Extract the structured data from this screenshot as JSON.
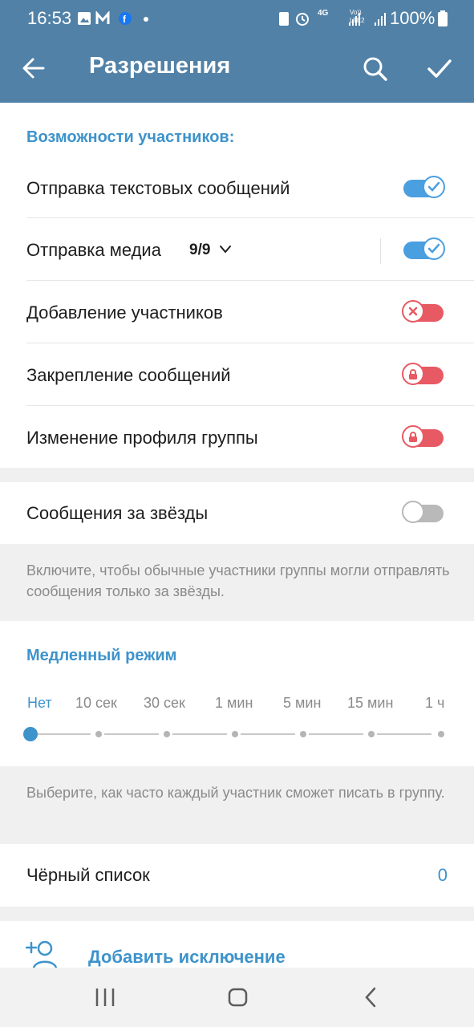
{
  "status_bar": {
    "time": "16:53",
    "battery": "100%",
    "network": "4G",
    "volte": "Vo)) LTE2"
  },
  "header": {
    "title": "Разрешения",
    "back_icon": "back-arrow-icon",
    "search_icon": "search-icon",
    "confirm_icon": "checkmark-icon"
  },
  "members_section": {
    "title": "Возможности участников:",
    "items": [
      {
        "label": "Отправка текстовых сообщений",
        "state": "on"
      },
      {
        "label": "Отправка медиа",
        "count": "9/9",
        "state": "on"
      },
      {
        "label": "Добавление участников",
        "state": "off"
      },
      {
        "label": "Закрепление сообщений",
        "state": "locked"
      },
      {
        "label": "Изменение профиля группы",
        "state": "locked"
      }
    ]
  },
  "stars": {
    "label": "Сообщения за звёзды",
    "state": "off",
    "info": "Включите, чтобы обычные участники группы могли отправлять сообщения только за звёзды."
  },
  "slow_mode": {
    "title": "Медленный режим",
    "options": [
      "Нет",
      "10 сек",
      "30 сек",
      "1 мин",
      "5 мин",
      "15 мин",
      "1 ч"
    ],
    "selected_index": 0,
    "info": "Выберите, как часто каждый участник сможет писать в группу."
  },
  "blacklist": {
    "label": "Чёрный список",
    "count": "0"
  },
  "add_exception": {
    "label": "Добавить исключение"
  },
  "colors": {
    "header": "#5181a7",
    "accent": "#3e93cb",
    "toggle_on": "#4a9fe0",
    "toggle_off_red": "#e85a63"
  }
}
